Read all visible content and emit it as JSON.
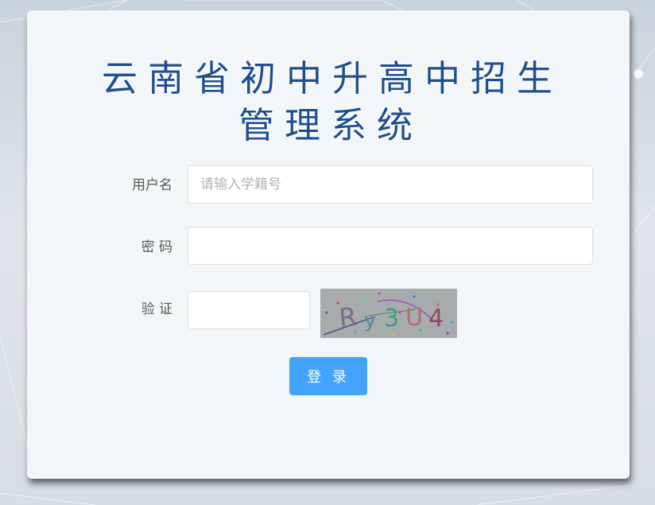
{
  "page": {
    "title_line1": "云南省初中升高中招生",
    "title_line2": "管理系统",
    "title_color": "#1f4f8f"
  },
  "form": {
    "username_label": "用户名",
    "username_placeholder": "请输入学籍号",
    "username_value": "",
    "password_label": "密 码",
    "password_value": "",
    "captcha_label": "验 证",
    "captcha_value": "",
    "captcha_image_text": "Ry3U4"
  },
  "actions": {
    "login_label": "登 录",
    "login_color": "#43a3fb"
  }
}
